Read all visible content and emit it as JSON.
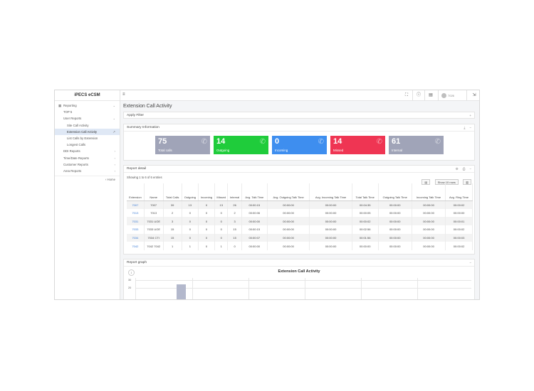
{
  "app": {
    "title": "iPECS eCSM"
  },
  "sidebar": {
    "items": [
      {
        "label": "Reporting",
        "level": 0,
        "chevron": "⌄"
      },
      {
        "label": "TOP 5",
        "level": 1
      },
      {
        "label": "User Reports",
        "level": 1,
        "chevron": "⌄"
      },
      {
        "label": "Site Call Activity",
        "level": 2
      },
      {
        "label": "Extension Call Activity",
        "level": 2,
        "active": true
      },
      {
        "label": "List Calls by Extension",
        "level": 2
      },
      {
        "label": "Longest Calls",
        "level": 2
      },
      {
        "label": "DDI Reports",
        "level": 1,
        "chevron": "‹"
      },
      {
        "label": "Time/Date Reports",
        "level": 1,
        "chevron": "‹"
      },
      {
        "label": "Customer Reports",
        "level": 1,
        "chevron": "‹"
      },
      {
        "label": "Area Reports",
        "level": 1,
        "chevron": "‹"
      }
    ],
    "home_label": "‹ Home"
  },
  "topbar": {
    "user_name": "7026"
  },
  "page": {
    "title": "Extension Call Activity"
  },
  "filter": {
    "label": "Apply Filter",
    "toggle": "+"
  },
  "summary": {
    "header": "Summary Information",
    "cards": [
      {
        "value": "75",
        "label": "Total calls",
        "color": "#a0a4b8",
        "icon": "phone-transfer-icon"
      },
      {
        "value": "14",
        "label": "Outgoing",
        "color": "#1fcc3b",
        "icon": "phone-outgoing-icon"
      },
      {
        "value": "0",
        "label": "Incoming",
        "color": "#3e8eef",
        "icon": "phone-incoming-icon"
      },
      {
        "value": "14",
        "label": "Missed",
        "color": "#ef3553",
        "icon": "phone-missed-icon"
      },
      {
        "value": "61",
        "label": "Internal",
        "color": "#a0a4b8",
        "icon": "phone-internal-icon"
      }
    ]
  },
  "report": {
    "header": "Report detail",
    "showing": "Showing 1 to 6 of 6 entries",
    "show_rows": "Show 10 rows",
    "columns": [
      "Extension",
      "Name",
      "Total Calls",
      "Outgoing",
      "Incoming",
      "Missed",
      "Internal",
      "Avg. Talk Time",
      "Avg. Outgoing Talk Time",
      "Avg. Incoming Talk Time",
      "Total Talk Time",
      "Outgoing Talk Time",
      "Incoming Talk Time",
      "Avg. Ring Time"
    ],
    "rows": [
      [
        "7007",
        "7007",
        "39",
        "13",
        "0",
        "13",
        "26",
        "00:00:15",
        "00:00:00",
        "00:00:00",
        "00:04:35",
        "00:00:00",
        "00:00:00",
        "00:00:02"
      ],
      [
        "7013",
        "7013",
        "2",
        "0",
        "0",
        "0",
        "2",
        "00:00:06",
        "00:00:00",
        "00:00:00",
        "00:00:05",
        "00:00:00",
        "00:00:00",
        "00:00:00"
      ],
      [
        "7031",
        "7031 UOE",
        "3",
        "0",
        "0",
        "0",
        "3",
        "00:00:00",
        "00:00:00",
        "00:00:00",
        "00:00:02",
        "00:00:00",
        "00:00:00",
        "00:00:01"
      ],
      [
        "7033",
        "7033 UOE",
        "15",
        "0",
        "0",
        "0",
        "15",
        "00:00:15",
        "00:00:00",
        "00:00:00",
        "00:02:56",
        "00:00:00",
        "00:00:00",
        "00:00:02"
      ],
      [
        "7034",
        "7034 CTI",
        "15",
        "0",
        "0",
        "0",
        "15",
        "00:00:07",
        "00:00:00",
        "00:00:00",
        "00:01:56",
        "00:00:00",
        "00:00:00",
        "00:00:03"
      ],
      [
        "7042",
        "7042 7042",
        "1",
        "1",
        "0",
        "1",
        "0",
        "00:00:00",
        "00:00:00",
        "00:00:00",
        "00:00:00",
        "00:00:00",
        "00:00:00",
        "00:00:02"
      ]
    ]
  },
  "graph": {
    "header": "Report graph",
    "chart_title": "Extension Call Activity",
    "ticks": [
      "30",
      "20"
    ]
  }
}
